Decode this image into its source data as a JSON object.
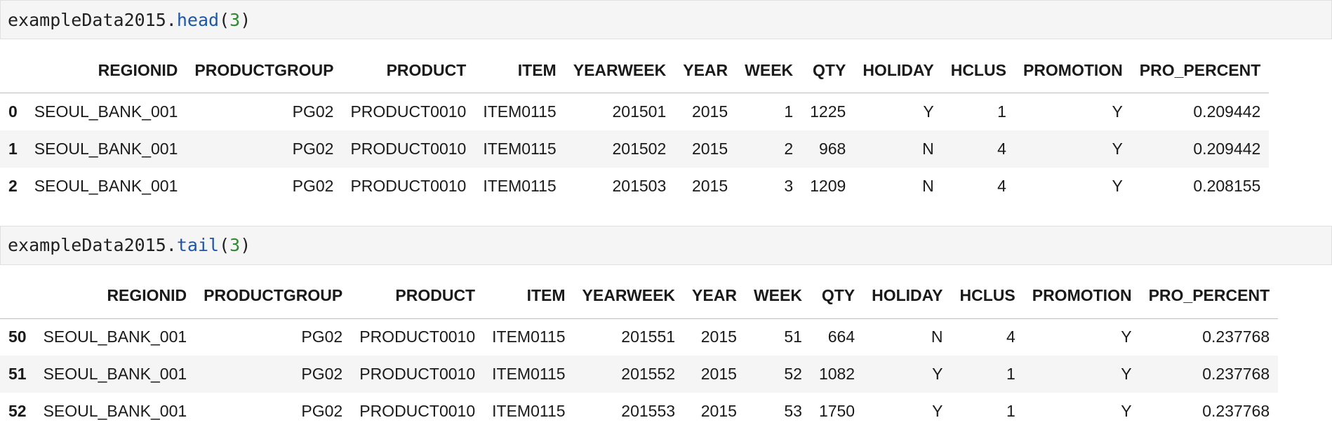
{
  "cells": [
    {
      "code": {
        "var": "exampleData2015",
        "dot": ".",
        "method": "head",
        "open": "(",
        "arg": "3",
        "close": ")"
      },
      "table": {
        "columns": [
          "",
          "REGIONID",
          "PRODUCTGROUP",
          "PRODUCT",
          "ITEM",
          "YEARWEEK",
          "YEAR",
          "WEEK",
          "QTY",
          "HOLIDAY",
          "HCLUS",
          "PROMOTION",
          "PRO_PERCENT"
        ],
        "rows": [
          [
            "0",
            "SEOUL_BANK_001",
            "PG02",
            "PRODUCT0010",
            "ITEM0115",
            "201501",
            "2015",
            "1",
            "1225",
            "Y",
            "1",
            "Y",
            "0.209442"
          ],
          [
            "1",
            "SEOUL_BANK_001",
            "PG02",
            "PRODUCT0010",
            "ITEM0115",
            "201502",
            "2015",
            "2",
            "968",
            "N",
            "4",
            "Y",
            "0.209442"
          ],
          [
            "2",
            "SEOUL_BANK_001",
            "PG02",
            "PRODUCT0010",
            "ITEM0115",
            "201503",
            "2015",
            "3",
            "1209",
            "N",
            "4",
            "Y",
            "0.208155"
          ]
        ]
      }
    },
    {
      "code": {
        "var": "exampleData2015",
        "dot": ".",
        "method": "tail",
        "open": "(",
        "arg": "3",
        "close": ")"
      },
      "table": {
        "columns": [
          "",
          "REGIONID",
          "PRODUCTGROUP",
          "PRODUCT",
          "ITEM",
          "YEARWEEK",
          "YEAR",
          "WEEK",
          "QTY",
          "HOLIDAY",
          "HCLUS",
          "PROMOTION",
          "PRO_PERCENT"
        ],
        "rows": [
          [
            "50",
            "SEOUL_BANK_001",
            "PG02",
            "PRODUCT0010",
            "ITEM0115",
            "201551",
            "2015",
            "51",
            "664",
            "N",
            "4",
            "Y",
            "0.237768"
          ],
          [
            "51",
            "SEOUL_BANK_001",
            "PG02",
            "PRODUCT0010",
            "ITEM0115",
            "201552",
            "2015",
            "52",
            "1082",
            "Y",
            "1",
            "Y",
            "0.237768"
          ],
          [
            "52",
            "SEOUL_BANK_001",
            "PG02",
            "PRODUCT0010",
            "ITEM0115",
            "201553",
            "2015",
            "53",
            "1750",
            "Y",
            "1",
            "Y",
            "0.237768"
          ]
        ]
      }
    }
  ]
}
